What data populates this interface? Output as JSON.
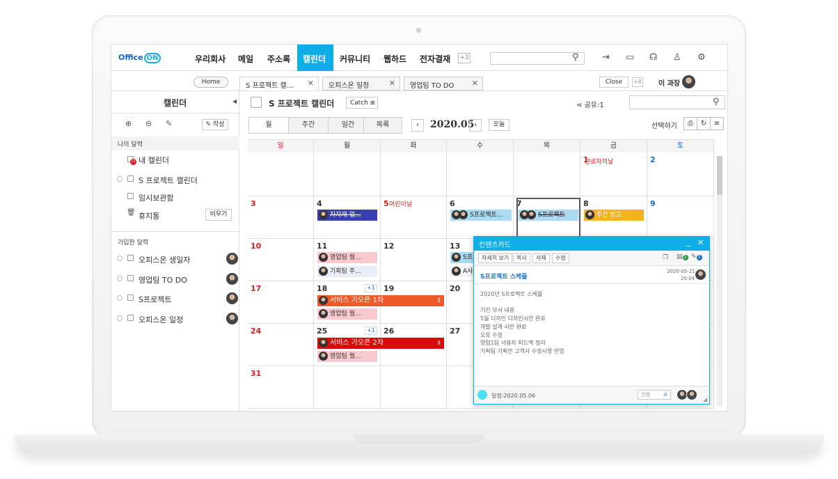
{
  "header": {
    "logo_text": "Office",
    "logo_on": "ON",
    "nav": [
      "우리회사",
      "메일",
      "주소록",
      "캘린더",
      "커뮤니티",
      "웹하드",
      "전자결재"
    ],
    "active_nav": "캘린더",
    "more_badge": "+3",
    "accent_color": "#10aee8"
  },
  "tabs": {
    "home": "Home",
    "items": [
      "S 프로젝트 캘...",
      "오피스온 일정",
      "영업팀 TO DO"
    ],
    "close": "Close",
    "plus_badge": "+8",
    "user": "이 과장"
  },
  "sidebar": {
    "title": "캘린더",
    "write": "작성",
    "my_section": "나의 달력",
    "my_badge": "11",
    "my_items": [
      "내 캘린더",
      "S 프로젝트 캘린더",
      "임시보관함",
      "휴지통"
    ],
    "empty_button": "비우기",
    "joined_section": "가입한 달력",
    "joined_items": [
      "오피스온 생일자",
      "영업팀 TO DO",
      "S프로젝트",
      "오피스온 일정"
    ]
  },
  "calendar": {
    "title": "S 프로젝트 캘린더",
    "catch_label": "Catch",
    "share_label": "공유:1",
    "views": [
      "월",
      "주간",
      "일간",
      "목록"
    ],
    "month": "2020.05",
    "today": "오늘",
    "select_label": "선택하기",
    "weekdays": [
      "일",
      "월",
      "화",
      "수",
      "목",
      "금",
      "토"
    ],
    "weeks": [
      [
        "",
        "",
        "",
        "",
        "",
        "1",
        "2"
      ],
      [
        "3",
        "4",
        "5",
        "6",
        "7",
        "8",
        "9"
      ],
      [
        "10",
        "11",
        "12",
        "13",
        "",
        "",
        ""
      ],
      [
        "17",
        "18",
        "19",
        "20",
        "",
        "",
        ""
      ],
      [
        "24",
        "25",
        "26",
        "27",
        "",
        "",
        ""
      ],
      [
        "31",
        "",
        "",
        "",
        "",
        "",
        ""
      ]
    ],
    "holidays": {
      "h1": "근로자의날",
      "h5": "어린이날"
    },
    "more_18": "+1",
    "more_25": "+1",
    "events": {
      "e4": "자자재 업...",
      "e6": "S프로젝트...",
      "e7": "S프로젝트",
      "e8": "주간 보고",
      "e11a": "영업팀 월...",
      "e11b": "기획팀 주...",
      "e13a": "S프",
      "e13b": "A사",
      "e18": "서비스 가오픈 1차",
      "e18b": "영업팀 월...",
      "e25": "서비스 가오픈 2차",
      "e25b": "영업팀 월..."
    }
  },
  "popup": {
    "title": "컨텐츠카드",
    "buttons": [
      "자세히 보기",
      "복사",
      "삭제",
      "수정"
    ],
    "badge1": "1",
    "badge2": "1",
    "item_title": "S프로젝트 스케쥴",
    "date": "2020-05-21",
    "time": "20:04",
    "lines": [
      "2020년 S프로젝트 스케쥴",
      "",
      "기간 부서 내용",
      "5월 디자인 디자인시안 완료",
      "개발 설계 시안 완료",
      "오류 수정",
      "영업1팀 사용자 피드백 정리",
      "기획팀 기획안 고객사 수정사항 반영"
    ],
    "footer": "일정:2020.05.06",
    "status": "진행"
  },
  "colors": {
    "blue_event": "#3a3fae",
    "lightblue_event": "#a9dcf3",
    "yellow_event": "#f2b41c",
    "pink_event": "#f9c9cf",
    "orange_event": "#ee5a2a",
    "red_event": "#d80b0b",
    "sunday": "#d81e1e",
    "saturday": "#1a6fd0"
  }
}
